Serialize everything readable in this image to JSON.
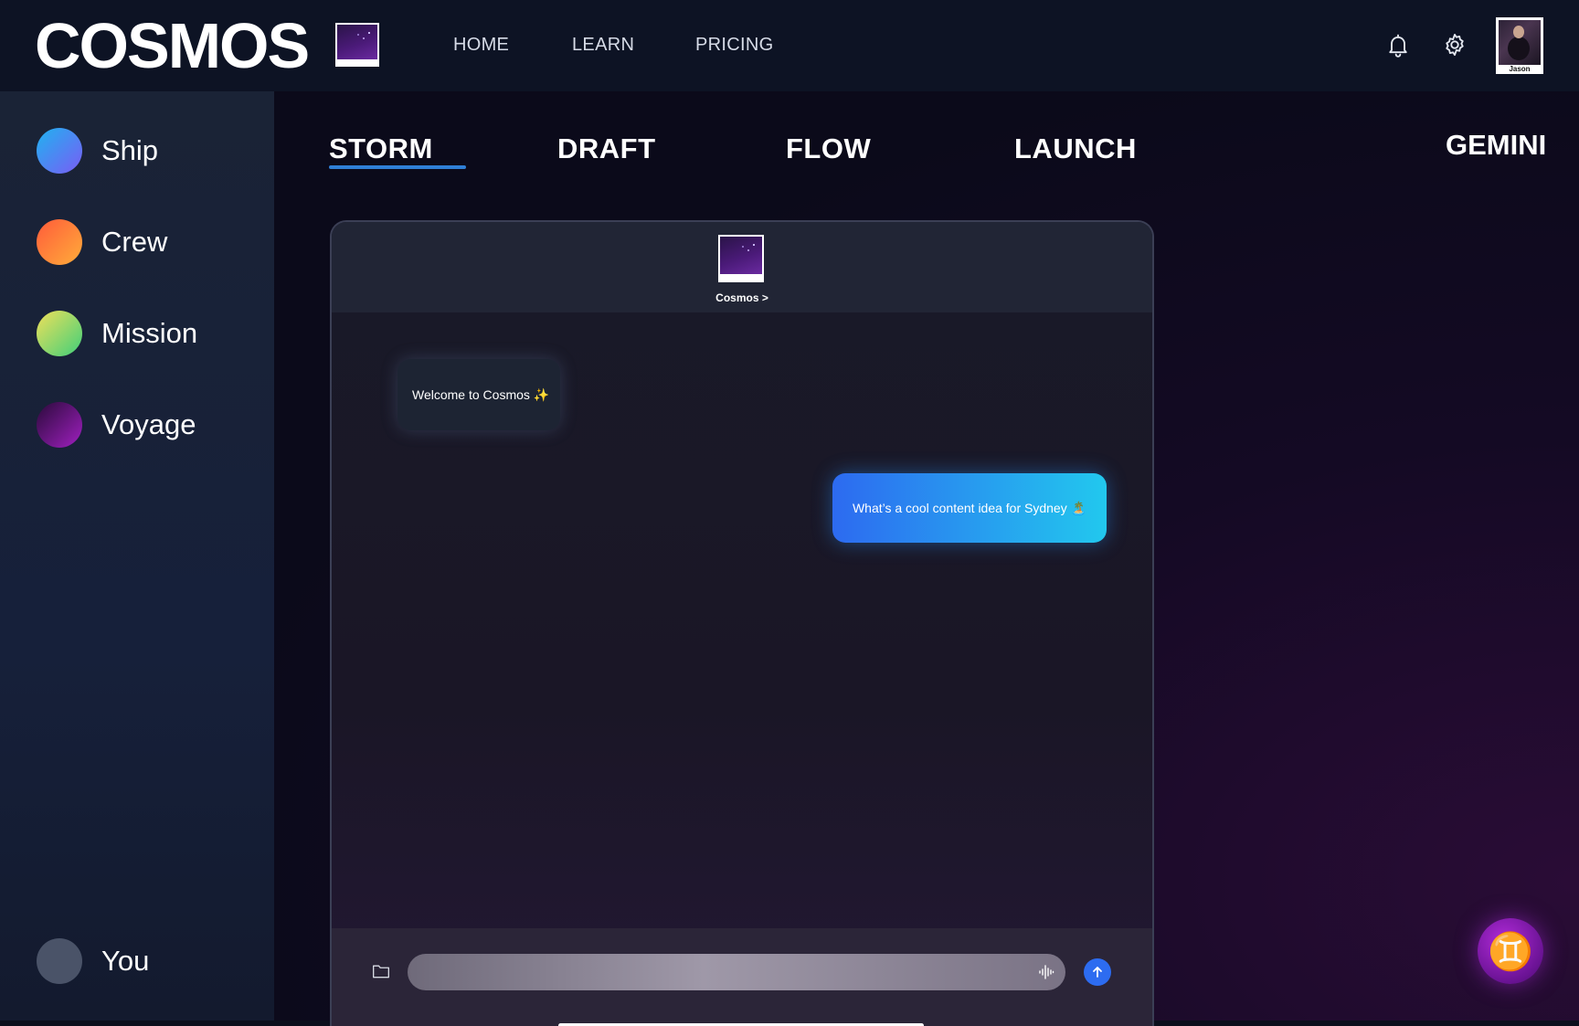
{
  "app": {
    "logo_text": "COSMOS"
  },
  "topnav": {
    "items": [
      {
        "label": "HOME"
      },
      {
        "label": "LEARN"
      },
      {
        "label": "PRICING"
      }
    ],
    "icons": [
      "bell-icon",
      "gear-icon"
    ],
    "user": {
      "name": "Jason"
    }
  },
  "sidebar": {
    "items": [
      {
        "label": "Ship",
        "color": "#3b8ef2"
      },
      {
        "label": "Crew",
        "color": "#ff7a3a"
      },
      {
        "label": "Mission",
        "color": "#9fdc6a"
      },
      {
        "label": "Voyage",
        "color": "#7a1aa0"
      }
    ],
    "footer_item": {
      "label": "You",
      "color": "#4a5368"
    }
  },
  "tabs": {
    "items": [
      {
        "label": "STORM",
        "active": true
      },
      {
        "label": "DRAFT",
        "active": false
      },
      {
        "label": "FLOW",
        "active": false
      },
      {
        "label": "LAUNCH",
        "active": false
      }
    ],
    "right_label": "GEMINI",
    "accent": "#2f7fd6"
  },
  "chat": {
    "contact_name": "Cosmos >",
    "messages": [
      {
        "direction": "incoming",
        "text": "Welcome to Cosmos ✨"
      },
      {
        "direction": "outgoing",
        "text": "What’s a cool content idea for Sydney 🏝️"
      }
    ],
    "input": {
      "value": "",
      "placeholder": ""
    },
    "send_color": "#2d6cf0"
  },
  "fab": {
    "glyph": "♊",
    "icon": "gemini-zodiac-icon",
    "color": "#a020c0"
  }
}
